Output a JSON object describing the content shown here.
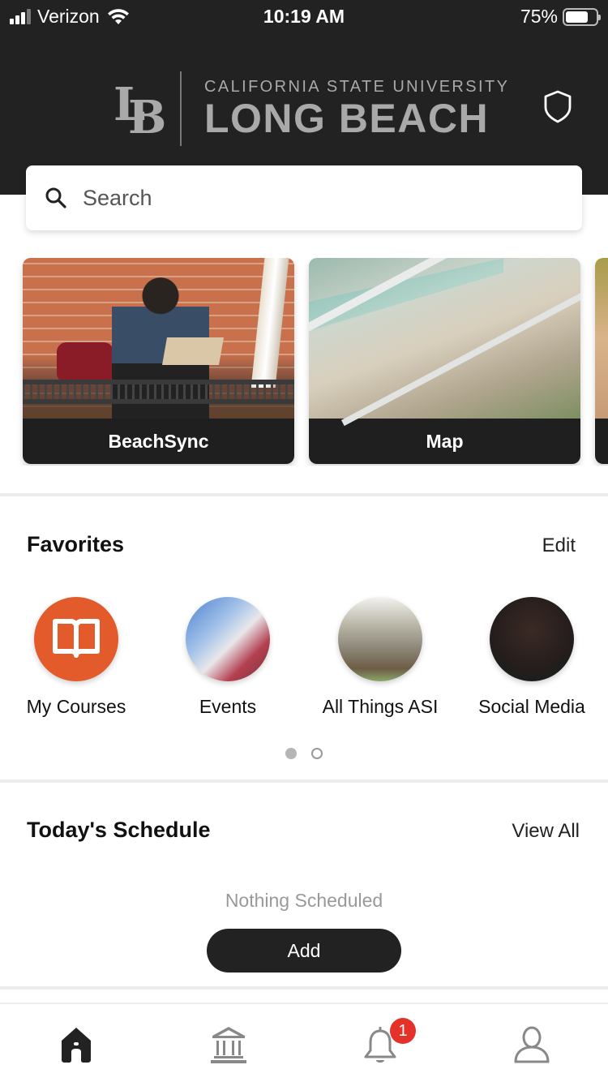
{
  "status_bar": {
    "carrier": "Verizon",
    "time": "10:19 AM",
    "battery_percent": "75%",
    "battery_level": 0.75,
    "signal_bars_active": 3,
    "signal_bars_total": 4
  },
  "header": {
    "logo_monogram": "LB",
    "logo_line1": "CALIFORNIA STATE UNIVERSITY",
    "logo_line2": "LONG BEACH",
    "shield_icon": "shield-icon"
  },
  "search": {
    "placeholder": "Search",
    "value": "",
    "icon": "search-icon"
  },
  "feature_cards": [
    {
      "label": "BeachSync",
      "image": "student-laptop-bench-photo"
    },
    {
      "label": "Map",
      "image": "escalator-students-photo"
    },
    {
      "label": "",
      "image": "partial-card-photo"
    }
  ],
  "favorites": {
    "title": "Favorites",
    "action": "Edit",
    "items": [
      {
        "label": "My Courses",
        "icon": "book-icon"
      },
      {
        "label": "Events",
        "icon": "events-photo"
      },
      {
        "label": "All Things ASI",
        "icon": "asi-building-photo"
      },
      {
        "label": "Social Media",
        "icon": "social-media-photo"
      }
    ],
    "page_count": 2,
    "current_page": 1
  },
  "schedule": {
    "title": "Today's Schedule",
    "action": "View All",
    "empty_text": "Nothing Scheduled",
    "add_label": "Add"
  },
  "tab_bar": {
    "items": [
      {
        "name": "home",
        "icon": "home-icon",
        "active": true
      },
      {
        "name": "campus",
        "icon": "institution-icon",
        "active": false
      },
      {
        "name": "notifications",
        "icon": "bell-icon",
        "active": false,
        "badge": "1"
      },
      {
        "name": "profile",
        "icon": "person-icon",
        "active": false
      }
    ]
  },
  "colors": {
    "header_bg": "#222222",
    "accent_orange": "#e35a2b",
    "badge_red": "#e4322b",
    "tab_active": "#222222",
    "tab_inactive": "#888888",
    "muted_text": "#999999"
  }
}
